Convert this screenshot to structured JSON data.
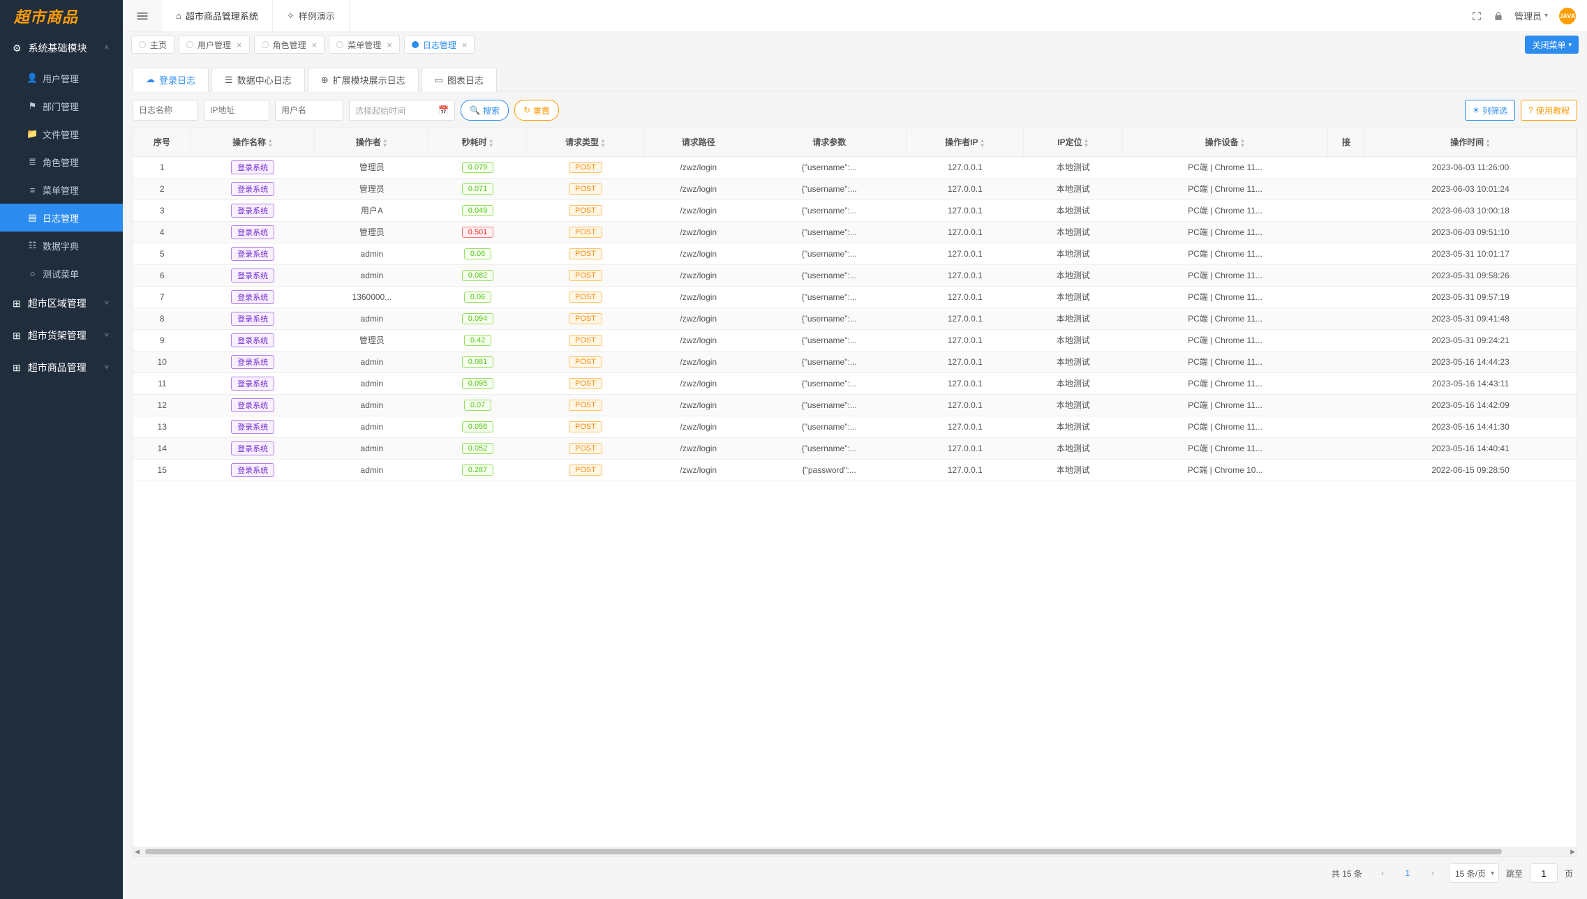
{
  "logo": "超市商品",
  "topTabs": [
    {
      "label": "超市商品管理系统",
      "icon": "home",
      "active": true
    },
    {
      "label": "样例演示",
      "icon": "sparkle",
      "active": false
    }
  ],
  "userLabel": "管理员",
  "avatarText": "JAVA",
  "sidebar": {
    "groups": [
      {
        "label": "系统基础模块",
        "icon": "gear",
        "expanded": true,
        "items": [
          {
            "label": "用户管理",
            "icon": "user"
          },
          {
            "label": "部门管理",
            "icon": "flag"
          },
          {
            "label": "文件管理",
            "icon": "folder"
          },
          {
            "label": "角色管理",
            "icon": "layers"
          },
          {
            "label": "菜单管理",
            "icon": "list"
          },
          {
            "label": "日志管理",
            "icon": "note",
            "active": true
          },
          {
            "label": "数据字典",
            "icon": "db"
          },
          {
            "label": "测试菜单",
            "icon": "dot"
          }
        ]
      },
      {
        "label": "超市区域管理",
        "icon": "grid",
        "expanded": false
      },
      {
        "label": "超市货架管理",
        "icon": "grid",
        "expanded": false
      },
      {
        "label": "超市商品管理",
        "icon": "grid",
        "expanded": false
      }
    ]
  },
  "pageTabs": [
    {
      "label": "主页",
      "closable": false
    },
    {
      "label": "用户管理",
      "closable": true
    },
    {
      "label": "角色管理",
      "closable": true
    },
    {
      "label": "菜单管理",
      "closable": true
    },
    {
      "label": "日志管理",
      "closable": true,
      "active": true
    }
  ],
  "closeMenuLabel": "关闭菜单",
  "contentTabs": [
    {
      "label": "登录日志",
      "icon": "cloud",
      "active": true
    },
    {
      "label": "数据中心日志",
      "icon": "list"
    },
    {
      "label": "扩展模块展示日志",
      "icon": "module"
    },
    {
      "label": "图表日志",
      "icon": "chart"
    }
  ],
  "filters": {
    "namePh": "日志名称",
    "ipPh": "IP地址",
    "userPh": "用户名",
    "datePh": "选择起始时间",
    "searchLabel": "搜索",
    "resetLabel": "重置",
    "columnsLabel": "列筛选",
    "tutorialLabel": "使用教程"
  },
  "columns": [
    "序号",
    "操作名称",
    "操作者",
    "秒耗时",
    "请求类型",
    "请求路径",
    "请求参数",
    "操作者IP",
    "IP定位",
    "操作设备",
    "接",
    "操作时间"
  ],
  "sortable": [
    false,
    true,
    true,
    true,
    true,
    false,
    false,
    true,
    true,
    true,
    false,
    true
  ],
  "rows": [
    {
      "idx": 1,
      "name": "登录系统",
      "oper": "管理员",
      "cost": "0.079",
      "slow": false,
      "type": "POST",
      "path": "/zwz/login",
      "param": "{\"username\":...",
      "ip": "127.0.0.1",
      "loc": "本地测试",
      "dev": "PC端 | Chrome 11...",
      "time": "2023-06-03 11:26:00"
    },
    {
      "idx": 2,
      "name": "登录系统",
      "oper": "管理员",
      "cost": "0.071",
      "slow": false,
      "type": "POST",
      "path": "/zwz/login",
      "param": "{\"username\":...",
      "ip": "127.0.0.1",
      "loc": "本地测试",
      "dev": "PC端 | Chrome 11...",
      "time": "2023-06-03 10:01:24"
    },
    {
      "idx": 3,
      "name": "登录系统",
      "oper": "用户A",
      "cost": "0.049",
      "slow": false,
      "type": "POST",
      "path": "/zwz/login",
      "param": "{\"username\":...",
      "ip": "127.0.0.1",
      "loc": "本地测试",
      "dev": "PC端 | Chrome 11...",
      "time": "2023-06-03 10:00:18"
    },
    {
      "idx": 4,
      "name": "登录系统",
      "oper": "管理员",
      "cost": "0.501",
      "slow": true,
      "type": "POST",
      "path": "/zwz/login",
      "param": "{\"username\":...",
      "ip": "127.0.0.1",
      "loc": "本地测试",
      "dev": "PC端 | Chrome 11...",
      "time": "2023-06-03 09:51:10"
    },
    {
      "idx": 5,
      "name": "登录系统",
      "oper": "admin",
      "cost": "0.06",
      "slow": false,
      "type": "POST",
      "path": "/zwz/login",
      "param": "{\"username\":...",
      "ip": "127.0.0.1",
      "loc": "本地测试",
      "dev": "PC端 | Chrome 11...",
      "time": "2023-05-31 10:01:17"
    },
    {
      "idx": 6,
      "name": "登录系统",
      "oper": "admin",
      "cost": "0.082",
      "slow": false,
      "type": "POST",
      "path": "/zwz/login",
      "param": "{\"username\":...",
      "ip": "127.0.0.1",
      "loc": "本地测试",
      "dev": "PC端 | Chrome 11...",
      "time": "2023-05-31 09:58:26"
    },
    {
      "idx": 7,
      "name": "登录系统",
      "oper": "1360000...",
      "cost": "0.06",
      "slow": false,
      "type": "POST",
      "path": "/zwz/login",
      "param": "{\"username\":...",
      "ip": "127.0.0.1",
      "loc": "本地测试",
      "dev": "PC端 | Chrome 11...",
      "time": "2023-05-31 09:57:19"
    },
    {
      "idx": 8,
      "name": "登录系统",
      "oper": "admin",
      "cost": "0.094",
      "slow": false,
      "type": "POST",
      "path": "/zwz/login",
      "param": "{\"username\":...",
      "ip": "127.0.0.1",
      "loc": "本地测试",
      "dev": "PC端 | Chrome 11...",
      "time": "2023-05-31 09:41:48"
    },
    {
      "idx": 9,
      "name": "登录系统",
      "oper": "管理员",
      "cost": "0.42",
      "slow": false,
      "type": "POST",
      "path": "/zwz/login",
      "param": "{\"username\":...",
      "ip": "127.0.0.1",
      "loc": "本地测试",
      "dev": "PC端 | Chrome 11...",
      "time": "2023-05-31 09:24:21"
    },
    {
      "idx": 10,
      "name": "登录系统",
      "oper": "admin",
      "cost": "0.081",
      "slow": false,
      "type": "POST",
      "path": "/zwz/login",
      "param": "{\"username\":...",
      "ip": "127.0.0.1",
      "loc": "本地测试",
      "dev": "PC端 | Chrome 11...",
      "time": "2023-05-16 14:44:23"
    },
    {
      "idx": 11,
      "name": "登录系统",
      "oper": "admin",
      "cost": "0.095",
      "slow": false,
      "type": "POST",
      "path": "/zwz/login",
      "param": "{\"username\":...",
      "ip": "127.0.0.1",
      "loc": "本地测试",
      "dev": "PC端 | Chrome 11...",
      "time": "2023-05-16 14:43:11"
    },
    {
      "idx": 12,
      "name": "登录系统",
      "oper": "admin",
      "cost": "0.07",
      "slow": false,
      "type": "POST",
      "path": "/zwz/login",
      "param": "{\"username\":...",
      "ip": "127.0.0.1",
      "loc": "本地测试",
      "dev": "PC端 | Chrome 11...",
      "time": "2023-05-16 14:42:09"
    },
    {
      "idx": 13,
      "name": "登录系统",
      "oper": "admin",
      "cost": "0.056",
      "slow": false,
      "type": "POST",
      "path": "/zwz/login",
      "param": "{\"username\":...",
      "ip": "127.0.0.1",
      "loc": "本地测试",
      "dev": "PC端 | Chrome 11...",
      "time": "2023-05-16 14:41:30"
    },
    {
      "idx": 14,
      "name": "登录系统",
      "oper": "admin",
      "cost": "0.052",
      "slow": false,
      "type": "POST",
      "path": "/zwz/login",
      "param": "{\"username\":...",
      "ip": "127.0.0.1",
      "loc": "本地测试",
      "dev": "PC端 | Chrome 11...",
      "time": "2023-05-16 14:40:41"
    },
    {
      "idx": 15,
      "name": "登录系统",
      "oper": "admin",
      "cost": "0.287",
      "slow": false,
      "type": "POST",
      "path": "/zwz/login",
      "param": "{\"password\":...",
      "ip": "127.0.0.1",
      "loc": "本地测试",
      "dev": "PC端 | Chrome 10...",
      "time": "2022-06-15 09:28:50"
    }
  ],
  "pagination": {
    "totalPrefix": "共 ",
    "totalCount": "15",
    "totalSuffix": " 条",
    "page": "1",
    "sizeLabel": "15 条/页",
    "jumpLabel": "跳至",
    "pageInput": "1",
    "pageUnit": "页"
  }
}
